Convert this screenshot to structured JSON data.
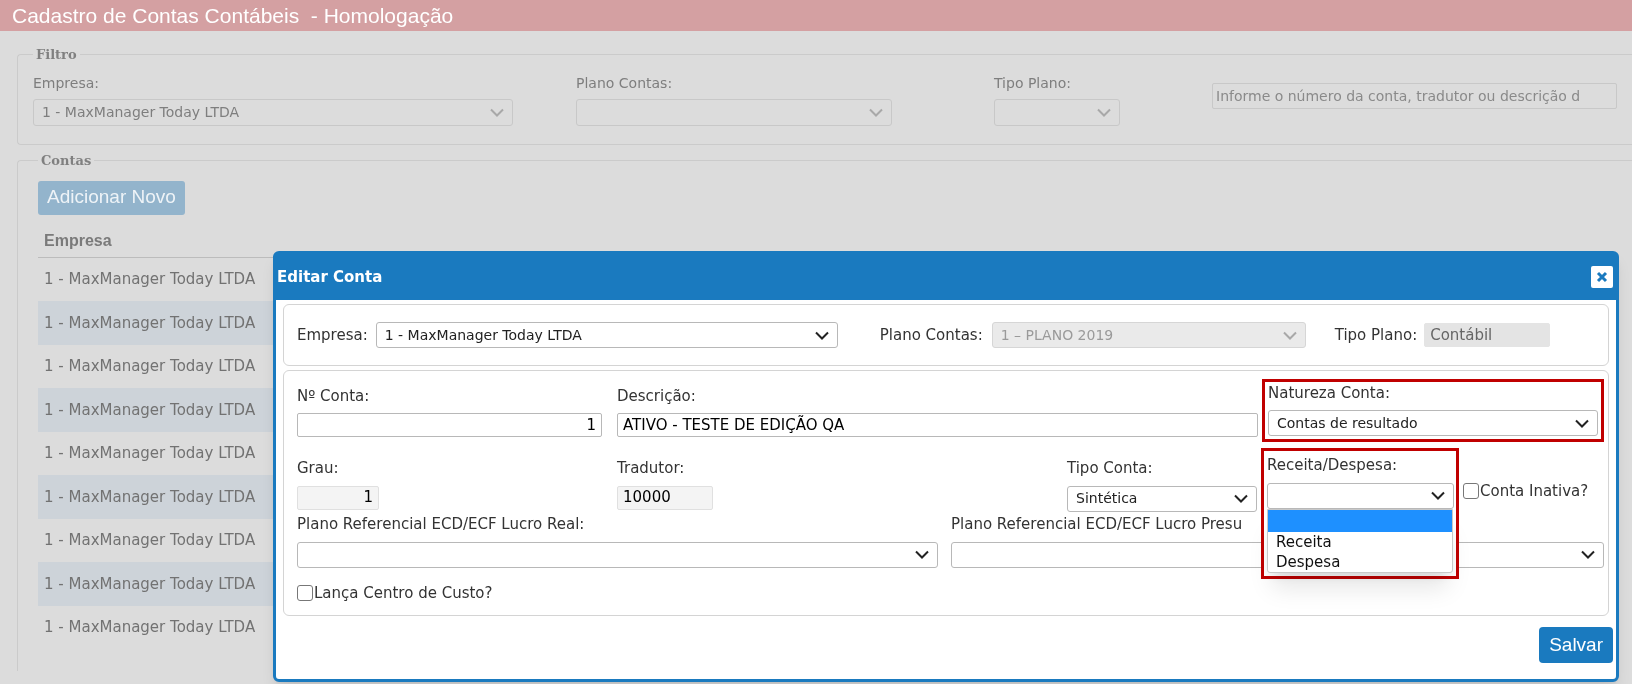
{
  "page": {
    "title": "Cadastro de Contas Contábeis  - Homologação",
    "filter": {
      "legend": "Filtro",
      "fields": [
        {
          "label": "Empresa:",
          "value": "1 - MaxManager Today LTDA"
        },
        {
          "label": "Plano Contas:"
        },
        {
          "label": "Tipo Plano:"
        }
      ],
      "search": {
        "placeholder": "Informe o número da conta, tradutor ou descrição d"
      }
    },
    "accounts": {
      "legend": "Contas",
      "add_button": "Adicionar Novo",
      "table": {
        "columns": [
          "Empresa"
        ],
        "rows": [
          [
            "1 - MaxManager Today LTDA"
          ],
          [
            "1 - MaxManager Today LTDA"
          ],
          [
            "1 - MaxManager Today LTDA"
          ],
          [
            "1 - MaxManager Today LTDA"
          ],
          [
            "1 - MaxManager Today LTDA"
          ],
          [
            "1 - MaxManager Today LTDA"
          ],
          [
            "1 - MaxManager Today LTDA"
          ],
          [
            "1 - MaxManager Today LTDA"
          ],
          [
            "1 - MaxManager Today LTDA"
          ]
        ]
      }
    }
  },
  "dialog": {
    "title": "Editar Conta",
    "header_fields": {
      "empresa": {
        "label": "Empresa:",
        "value": "1 - MaxManager Today LTDA"
      },
      "plano_contas": {
        "label": "Plano Contas:",
        "value": "1 – PLANO 2019",
        "disabled": true
      },
      "tipo_plano": {
        "label": "Tipo Plano:",
        "value": "Contábil"
      }
    },
    "numero_conta": {
      "label": "Nº Conta:",
      "value": "1"
    },
    "descricao": {
      "label": "Descrição:",
      "value": "ATIVO - TESTE DE EDIÇÃO QA"
    },
    "natureza_conta": {
      "label": "Natureza Conta:",
      "value": "Contas de resultado",
      "highlighted": true
    },
    "grau": {
      "label": "Grau:",
      "value": "1"
    },
    "tradutor": {
      "label": "Tradutor:",
      "value": "10000"
    },
    "tipo_conta": {
      "label": "Tipo Conta:",
      "value": "Sintética"
    },
    "receita_despesa": {
      "label": "Receita/Despesa:",
      "highlighted": true,
      "expanded": true,
      "options": [
        {
          "selected": true
        },
        {
          "label": "Receita",
          "selected": false
        },
        {
          "label": "Despesa",
          "selected": false
        }
      ]
    },
    "conta_inativa": {
      "label": "Conta Inativa?",
      "checked": false
    },
    "plano_ref_real": {
      "label": "Plano Referencial ECD/ECF Lucro Real:"
    },
    "plano_ref_presumido": {
      "label": "Plano Referencial ECD/ECF Lucro Presu"
    },
    "lanca_centro_custo": {
      "label": "Lança Centro de Custo?",
      "checked": false
    },
    "save_button": "Salvar"
  }
}
